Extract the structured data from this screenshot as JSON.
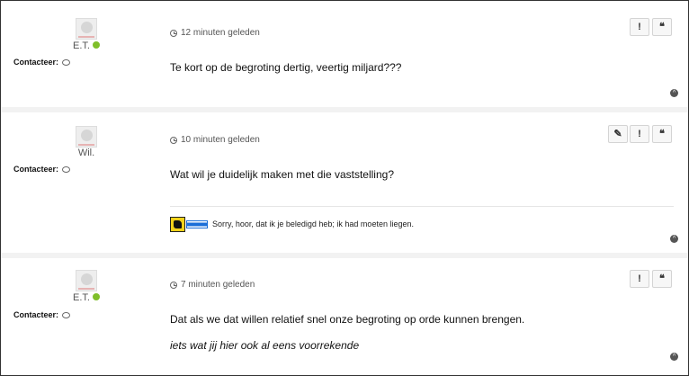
{
  "posts": [
    {
      "author": "E.T.",
      "online": true,
      "contact_label": "Contacteer:",
      "time": "12 minuten geleden",
      "body": [
        "Te kort op de begroting dertig, veertig miljard???"
      ],
      "buttons": [
        "!",
        "❝"
      ]
    },
    {
      "author": "Wil.",
      "online": false,
      "contact_label": "Contacteer:",
      "time": "10 minuten geleden",
      "body": [
        "Wat wil je duidelijk maken met die vaststelling?"
      ],
      "signature": "Sorry, hoor, dat ik je beledigd heb; ik had moeten liegen.",
      "buttons": [
        "✎",
        "!",
        "❝"
      ]
    },
    {
      "author": "E.T.",
      "online": true,
      "contact_label": "Contacteer:",
      "time": "7 minuten geleden",
      "body": [
        "Dat als we dat willen relatief snel onze begroting op orde kunnen brengen.",
        "iets wat jij hier ook al eens voorrekende"
      ],
      "buttons": [
        "!",
        "❝"
      ]
    }
  ],
  "icons": {
    "clock": "clock-icon",
    "chat": "chat-bubble-icon",
    "report": "exclamation-icon",
    "quote": "quote-icon",
    "edit": "pencil-icon",
    "top": "chevron-up-circle-icon"
  },
  "colors": {
    "online": "#7fbf2a",
    "flag_yellow": "#f3d21a",
    "banner_blue": "#1a6ed8"
  }
}
